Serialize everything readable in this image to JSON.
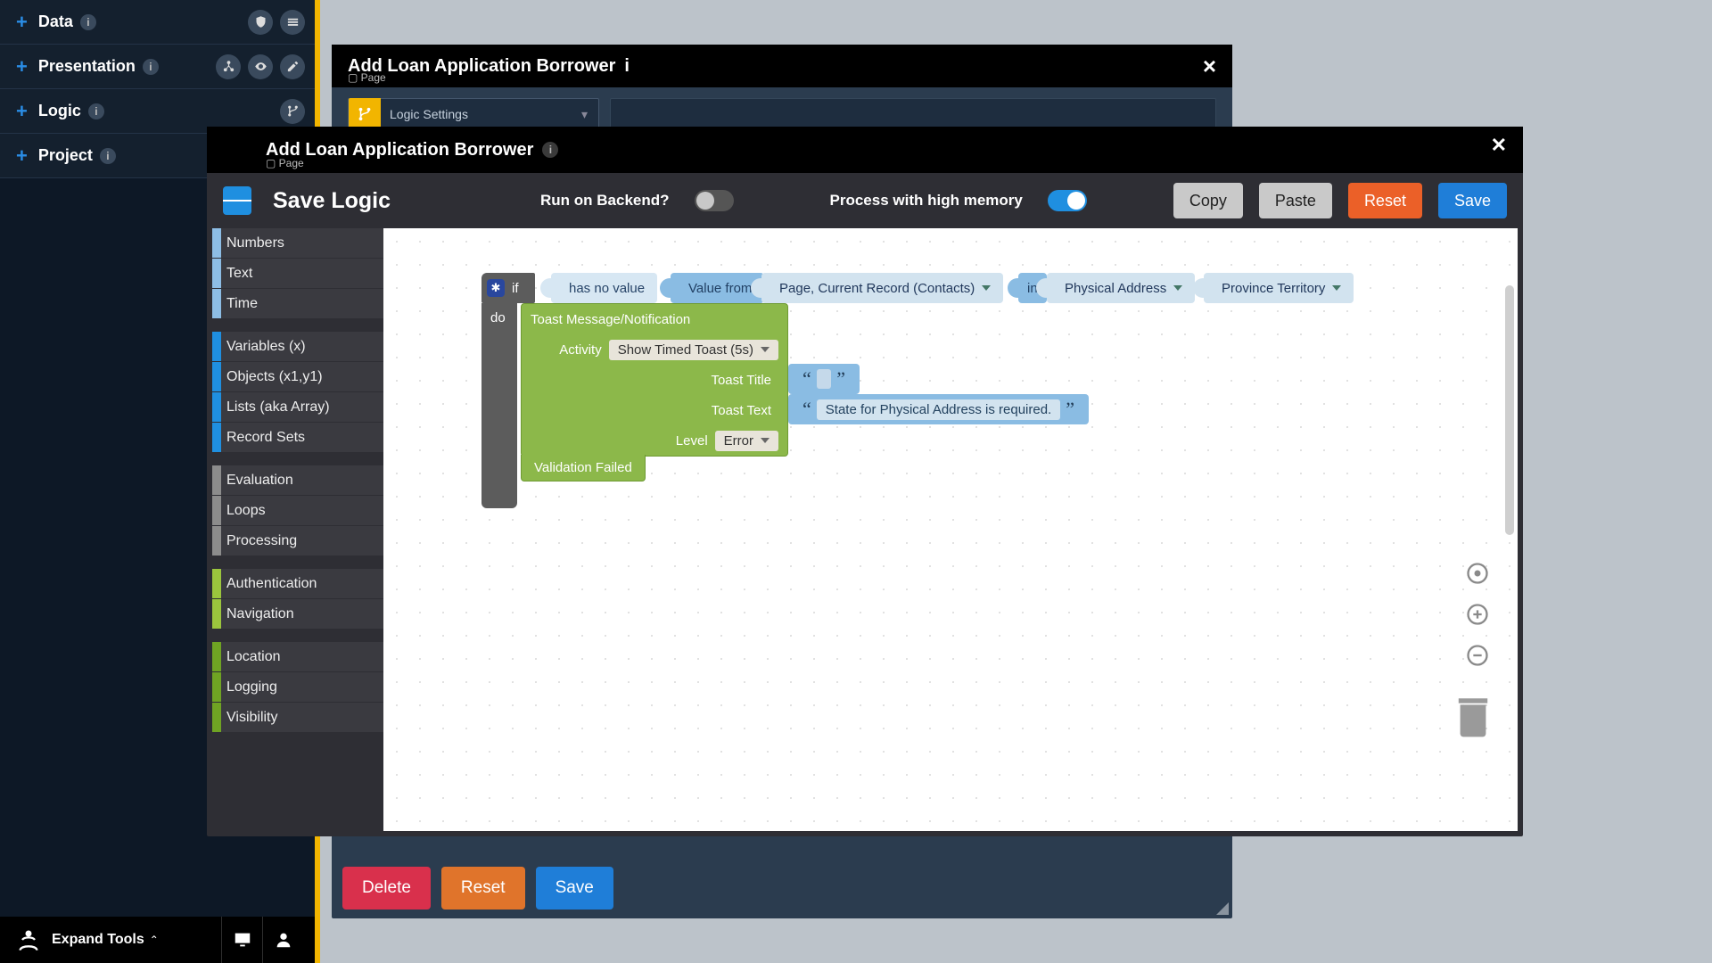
{
  "rail": {
    "items": [
      {
        "label": "Data",
        "icons": [
          "shield",
          "stack"
        ]
      },
      {
        "label": "Presentation",
        "icons": [
          "tree",
          "eye",
          "pen"
        ]
      },
      {
        "label": "Logic",
        "icons": [
          "branch"
        ]
      },
      {
        "label": "Project",
        "icons": []
      }
    ],
    "expand": "Expand Tools"
  },
  "back_panel": {
    "title": "Add Loan Application Borrower",
    "subtitle_prefix": "Page",
    "logic_select": "Logic Settings",
    "buttons": {
      "delete": "Delete",
      "reset": "Reset",
      "save": "Save"
    }
  },
  "modal": {
    "title": "Add Loan Application Borrower",
    "subtitle_prefix": "Page",
    "toolbar": {
      "heading": "Save Logic",
      "backend_label": "Run on Backend?",
      "backend_on": false,
      "memory_label": "Process with high memory",
      "memory_on": true,
      "copy": "Copy",
      "paste": "Paste",
      "reset": "Reset",
      "save": "Save"
    },
    "categories": [
      {
        "group": [
          {
            "n": "Numbers",
            "c": "lightblue"
          },
          {
            "n": "Text",
            "c": "lightblue"
          },
          {
            "n": "Time",
            "c": "lightblue"
          }
        ]
      },
      {
        "group": [
          {
            "n": "Variables (x)",
            "c": "blue"
          },
          {
            "n": "Objects (x1,y1)",
            "c": "blue"
          },
          {
            "n": "Lists (aka Array)",
            "c": "blue"
          },
          {
            "n": "Record Sets",
            "c": "blue"
          }
        ]
      },
      {
        "group": [
          {
            "n": "Evaluation",
            "c": "grey"
          },
          {
            "n": "Loops",
            "c": "grey"
          },
          {
            "n": "Processing",
            "c": "grey"
          }
        ]
      },
      {
        "group": [
          {
            "n": "Authentication",
            "c": "green"
          },
          {
            "n": "Navigation",
            "c": "green"
          }
        ]
      },
      {
        "group": [
          {
            "n": "Location",
            "c": "olive"
          },
          {
            "n": "Logging",
            "c": "olive"
          },
          {
            "n": "Visibility",
            "c": "olive"
          }
        ]
      }
    ],
    "block": {
      "if": "if",
      "do": "do",
      "has_no_value": "has no value",
      "value_from": "Value from",
      "source": "Page, Current Record (Contacts)",
      "in": "in",
      "field1": "Physical Address",
      "field2": "Province Territory",
      "toast_header": "Toast Message/Notification",
      "activity_label": "Activity",
      "activity_value": "Show Timed Toast (5s)",
      "title_label": "Toast Title",
      "title_value": "",
      "text_label": "Toast Text",
      "text_value": "State for Physical Address is required.",
      "level_label": "Level",
      "level_value": "Error",
      "validation": "Validation Failed"
    }
  }
}
